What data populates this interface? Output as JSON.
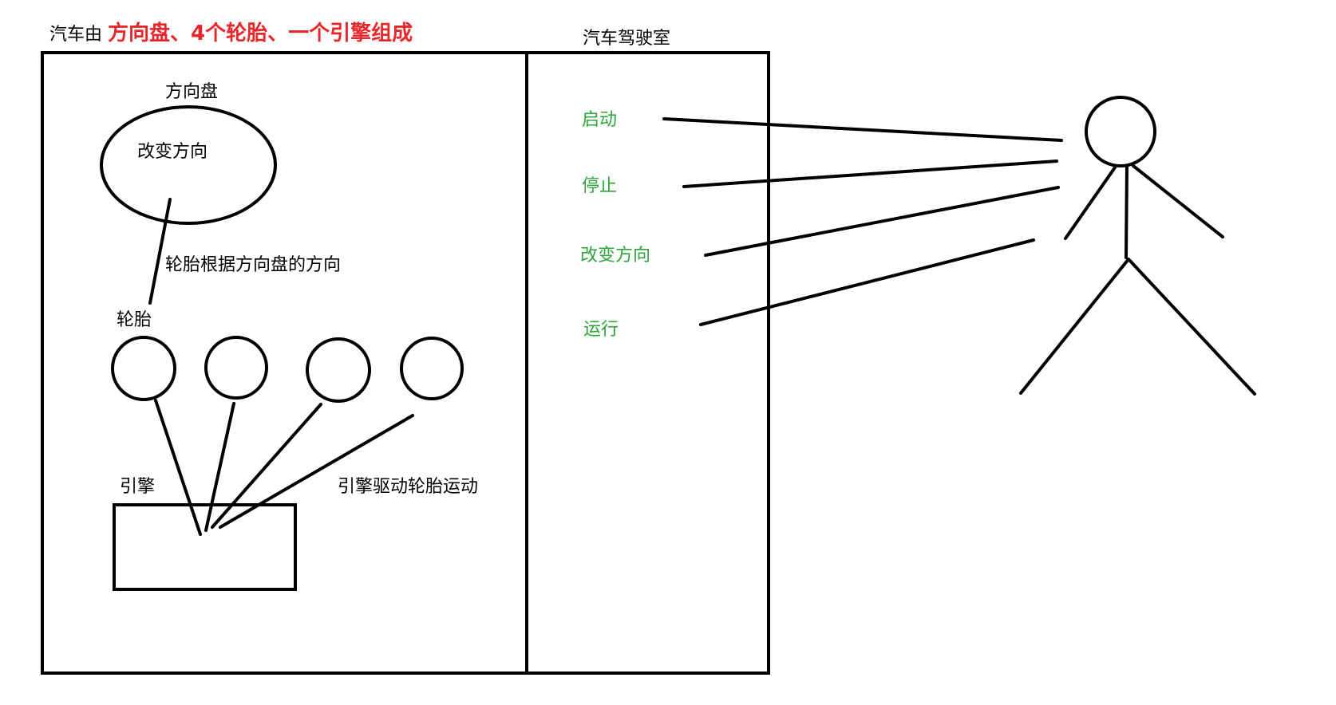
{
  "colors": {
    "ink": "#000000",
    "highlight": "#e8272b",
    "action": "#2ca53a",
    "background": "#ffffff"
  },
  "header": {
    "prefix": "汽车由 ",
    "highlight": "方向盘、4个轮胎、一个引擎组成"
  },
  "car": {
    "steering_wheel_label": "方向盘",
    "steering_wheel_inner": "改变方向",
    "steering_link_label": "轮胎根据方向盘的方向",
    "tires_label": "轮胎",
    "tire_count": 4,
    "engine_label": "引擎",
    "engine_drive_label": "引擎驱动轮胎运动"
  },
  "cab": {
    "title": "汽车驾驶室",
    "actions": [
      "启动",
      "停止",
      "改变方向",
      "运行"
    ]
  }
}
